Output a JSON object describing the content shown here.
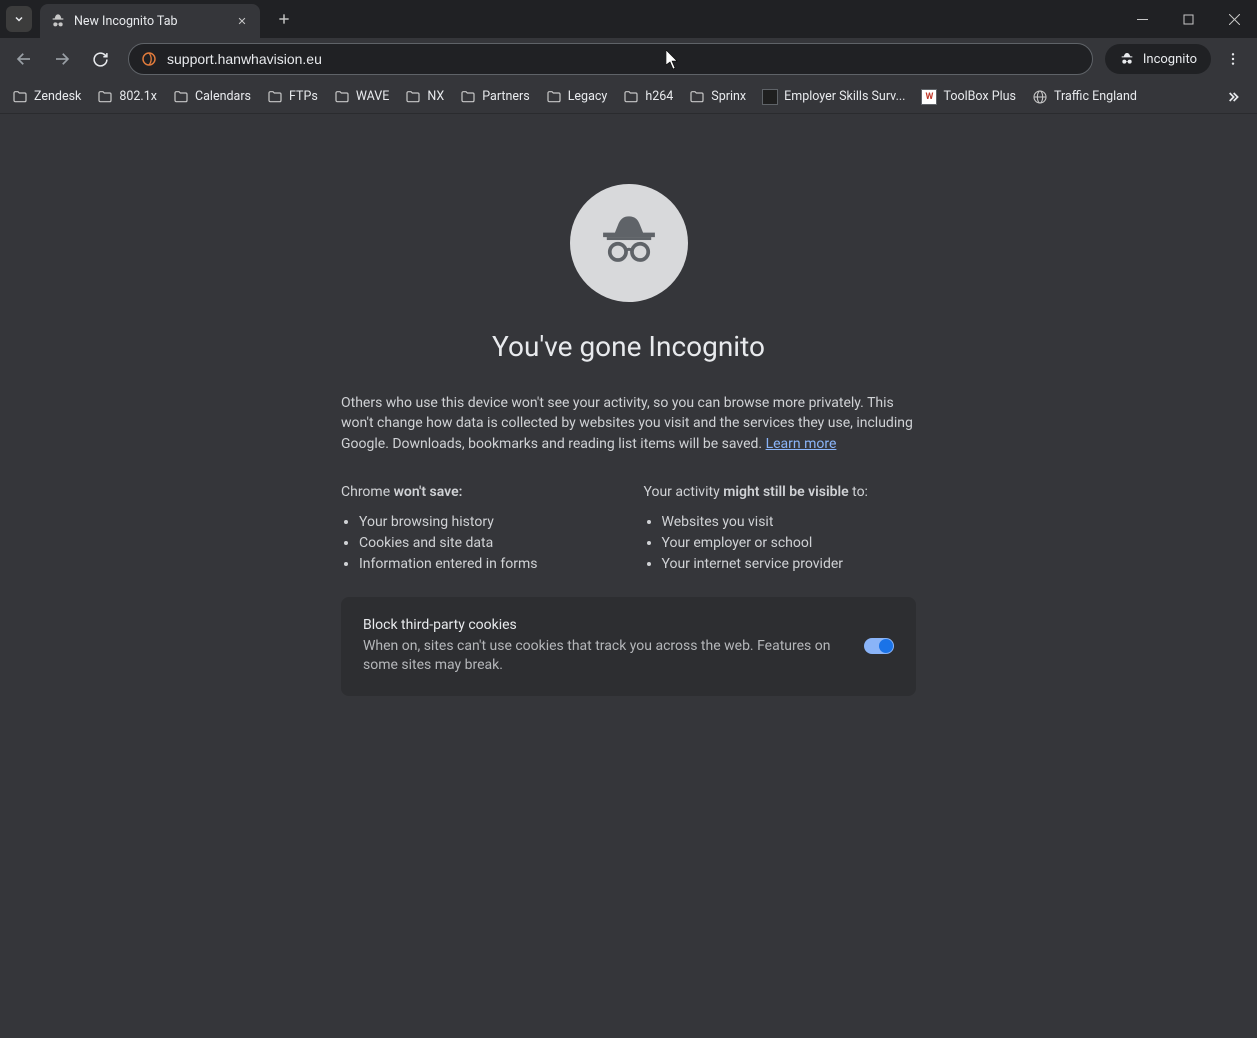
{
  "tab": {
    "title": "New Incognito Tab"
  },
  "omnibox": {
    "url": "support.hanwhavision.eu"
  },
  "incognito_chip": {
    "label": "Incognito"
  },
  "bookmarks": [
    {
      "label": "Zendesk",
      "type": "folder"
    },
    {
      "label": "802.1x",
      "type": "folder"
    },
    {
      "label": "Calendars",
      "type": "folder"
    },
    {
      "label": "FTPs",
      "type": "folder"
    },
    {
      "label": "WAVE",
      "type": "folder"
    },
    {
      "label": "NX",
      "type": "folder"
    },
    {
      "label": "Partners",
      "type": "folder"
    },
    {
      "label": "Legacy",
      "type": "folder"
    },
    {
      "label": "h264",
      "type": "folder"
    },
    {
      "label": "Sprinx",
      "type": "folder"
    },
    {
      "label": "Employer Skills Surv...",
      "type": "site",
      "iconColor": "#1f1f1f",
      "iconText": ""
    },
    {
      "label": "ToolBox Plus",
      "type": "site",
      "iconColor": "#ffffff",
      "iconText": "W"
    },
    {
      "label": "Traffic England",
      "type": "globe"
    }
  ],
  "page": {
    "heading": "You've gone Incognito",
    "intro_pre": "Others who use this device won't see your activity, so you can browse more privately. This won't change how data is collected by websites you visit and the services they use, including Google. Downloads, bookmarks and reading list items will be saved. ",
    "learn_more": "Learn more",
    "col1_title_pre": "Chrome ",
    "col1_title_b": "won't save:",
    "col1_items": [
      "Your browsing history",
      "Cookies and site data",
      "Information entered in forms"
    ],
    "col2_title_pre": "Your activity ",
    "col2_title_b": "might still be visible",
    "col2_title_post": " to:",
    "col2_items": [
      "Websites you visit",
      "Your employer or school",
      "Your internet service provider"
    ],
    "cookie_title": "Block third-party cookies",
    "cookie_desc": "When on, sites can't use cookies that track you across the web. Features on some sites may break."
  }
}
